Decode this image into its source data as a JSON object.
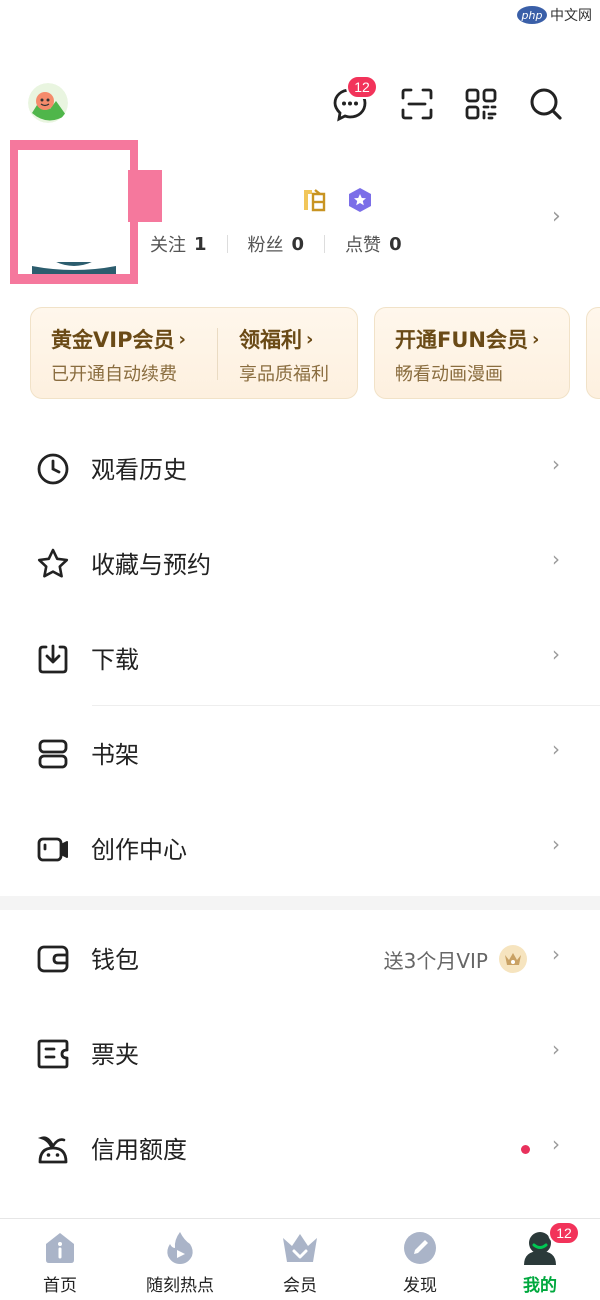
{
  "watermark": {
    "logo": "php",
    "text": "中文网"
  },
  "header": {
    "message_badge": "12",
    "icons": [
      "message-icon",
      "scan-icon",
      "qrcode-icon",
      "search-icon"
    ]
  },
  "profile": {
    "stats": [
      {
        "label": "关注",
        "value": "1"
      },
      {
        "label": "粉丝",
        "value": "0"
      },
      {
        "label": "点赞",
        "value": "0"
      }
    ]
  },
  "vip_cards": [
    {
      "cells": [
        {
          "title": "黄金VIP会员",
          "subtitle": "已开通自动续费"
        },
        {
          "title": "领福利",
          "subtitle": "享品质福利"
        }
      ]
    },
    {
      "cells": [
        {
          "title": "开通FUN会员",
          "subtitle": "畅看动画漫画"
        }
      ]
    }
  ],
  "menu_primary": [
    {
      "label": "观看历史",
      "icon": "clock-icon"
    },
    {
      "label": "收藏与预约",
      "icon": "star-icon"
    },
    {
      "label": "下载",
      "icon": "download-icon"
    },
    {
      "label": "书架",
      "icon": "bookshelf-icon"
    },
    {
      "label": "创作中心",
      "icon": "camera-icon"
    }
  ],
  "menu_secondary": [
    {
      "label": "钱包",
      "icon": "wallet-icon",
      "extra": "送3个月VIP"
    },
    {
      "label": "票夹",
      "icon": "ticket-icon"
    },
    {
      "label": "信用额度",
      "icon": "credit-icon"
    }
  ],
  "bottom_nav": [
    {
      "label": "首页",
      "icon": "home-icon",
      "active": false
    },
    {
      "label": "随刻热点",
      "icon": "flame-icon",
      "active": false
    },
    {
      "label": "会员",
      "icon": "crown-icon",
      "active": false
    },
    {
      "label": "发现",
      "icon": "compass-icon",
      "active": false
    },
    {
      "label": "我的",
      "icon": "profile-icon",
      "active": true,
      "badge": "12"
    }
  ],
  "colors": {
    "accent_green": "#00a83e",
    "badge_red": "#f2335a",
    "vip_brown": "#6a4a16",
    "highlight_pink": "#f5789d"
  },
  "chevron": "›"
}
